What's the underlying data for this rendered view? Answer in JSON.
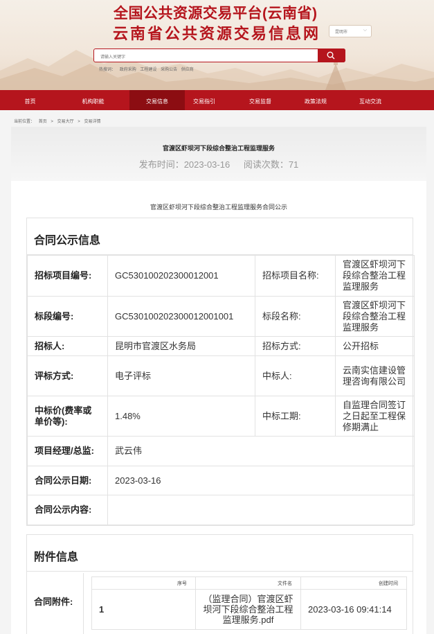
{
  "header": {
    "title_line1": "全国公共资源交易平台(云南省)",
    "title_line2": "云南省公共资源交易信息网",
    "city_select": "昆明市",
    "search_placeholder": "请输入关键字",
    "hotwords_label": "热搜词：",
    "hotwords": [
      "政府采购",
      "工程建设",
      "采购公告",
      "供应商"
    ]
  },
  "nav": {
    "items": [
      "首页",
      "机构职能",
      "交易信息",
      "交易指引",
      "交易监督",
      "政策法规",
      "互动交流"
    ],
    "active_index": 2
  },
  "breadcrumb": {
    "label": "当前位置：",
    "items": [
      "首页",
      ">",
      "交易大厅",
      ">",
      "交易详情"
    ]
  },
  "article": {
    "title": "官渡区虾坝河下段综合整治工程监理服务",
    "publish_time": "发布时间：2023-03-16",
    "read_count": "阅读次数：71",
    "subtitle": "官渡区虾坝河下段综合整治工程监理服务合同公示"
  },
  "contract": {
    "section_title": "合同公示信息",
    "rows": [
      {
        "l1": "招标项目编号:",
        "v1": "GC530100202300012001",
        "l2": "招标项目名称:",
        "v2": "官渡区虾坝河下段综合整治工程监理服务"
      },
      {
        "l1": "标段编号:",
        "v1": "GC530100202300012001001",
        "l2": "标段名称:",
        "v2": "官渡区虾坝河下段综合整治工程监理服务"
      },
      {
        "l1": "招标人:",
        "v1": "昆明市官渡区水务局",
        "l2": "招标方式:",
        "v2": "公开招标"
      },
      {
        "l1": "评标方式:",
        "v1": "电子评标",
        "l2": "中标人:",
        "v2": "云南实信建设管理咨询有限公司"
      },
      {
        "l1": "中标价(费率或单价等):",
        "v1": "1.48%",
        "l2": "中标工期:",
        "v2": "自监理合同签订之日起至工程保修期满止"
      }
    ],
    "wide_rows": [
      {
        "label": "项目经理/总监:",
        "value": "武云伟"
      },
      {
        "label": "合同公示日期:",
        "value": "2023-03-16"
      },
      {
        "label": "合同公示内容:",
        "value": ""
      }
    ]
  },
  "attachments": {
    "section_title": "附件信息",
    "row_label": "合同附件:",
    "columns": [
      "序号",
      "文件名",
      "创建时间"
    ],
    "files": [
      {
        "no": "1",
        "name": "（监理合同）官渡区虾坝河下段综合整治工程监理服务.pdf",
        "time": "2023-03-16 09:41:14"
      }
    ]
  },
  "colors": {
    "brand_red": "#b5151d",
    "nav_active": "#8c0d12"
  }
}
